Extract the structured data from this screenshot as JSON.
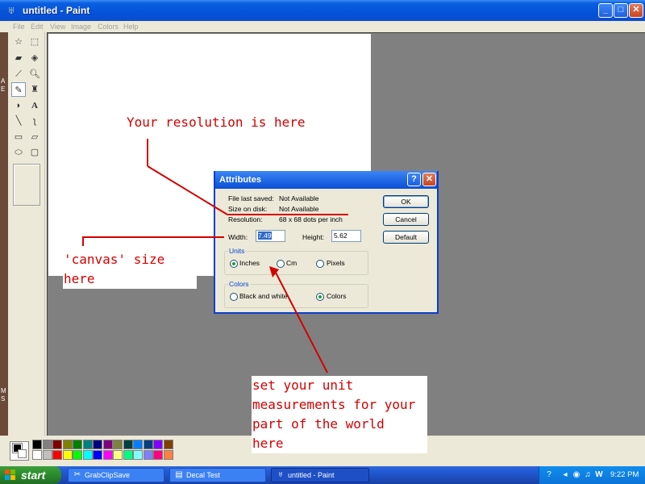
{
  "window": {
    "title": "untitled - Paint"
  },
  "menu": [
    "File",
    "Edit",
    "View",
    "Image",
    "Colors",
    "Help"
  ],
  "desktop_edge_text": [
    "A",
    "E",
    "M",
    "S"
  ],
  "tools": [
    "free-select",
    "rect-select",
    "eraser",
    "fill",
    "eyedropper",
    "magnifier",
    "pencil",
    "brush",
    "airbrush",
    "text",
    "line",
    "curve",
    "rectangle",
    "polygon",
    "ellipse",
    "rounded-rect"
  ],
  "palette": {
    "row1": [
      "#000000",
      "#808080",
      "#800000",
      "#808000",
      "#008000",
      "#008080",
      "#000080",
      "#800080",
      "#808040",
      "#004040",
      "#0080ff",
      "#004080",
      "#8000ff",
      "#804000"
    ],
    "row2": [
      "#ffffff",
      "#c0c0c0",
      "#ff0000",
      "#ffff00",
      "#00ff00",
      "#00ffff",
      "#0000ff",
      "#ff00ff",
      "#ffff80",
      "#00ff80",
      "#80ffff",
      "#8080ff",
      "#ff0080",
      "#ff8040"
    ]
  },
  "dialog": {
    "title": "Attributes",
    "file_last_saved_label": "File last saved:",
    "file_last_saved_value": "Not Available",
    "size_on_disk_label": "Size on disk:",
    "size_on_disk_value": "Not Available",
    "resolution_label": "Resolution:",
    "resolution_value": "68 x 68 dots per inch",
    "width_label": "Width:",
    "width_value": "7.49",
    "height_label": "Height:",
    "height_value": "5.62",
    "ok": "OK",
    "cancel": "Cancel",
    "default": "Default",
    "units_title": "Units",
    "units": [
      "Inches",
      "Cm",
      "Pixels"
    ],
    "units_selected": "Inches",
    "colors_title": "Colors",
    "colors": [
      "Black and white",
      "Colors"
    ],
    "colors_selected": "Colors"
  },
  "annotations": {
    "resolution": "Your resolution is here",
    "canvas": "'canvas' size\nhere",
    "units": "set your unit\nmeasurements for your\npart of the world\nhere"
  },
  "taskbar": {
    "start": "start",
    "tasks": [
      "GrabClipSave",
      "Decal Test",
      "untitled - Paint"
    ],
    "active_task": "untitled - Paint",
    "clock": "9:22 PM"
  },
  "colors": {
    "annotation_red": "#d40000",
    "xp_blue": "#0a4ed6"
  }
}
